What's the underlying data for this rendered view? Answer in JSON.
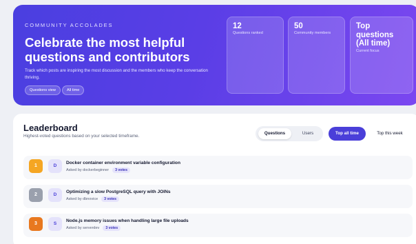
{
  "hero": {
    "eyebrow": "COMMUNITY ACCOLADES",
    "title": "Celebrate the most helpful questions and contributors",
    "description": "Track which posts are inspiring the most discussion and the members who keep the conversation thriving.",
    "chips": [
      "Questions view",
      "All time"
    ],
    "stats": [
      {
        "value": "12",
        "label": "Questions ranked"
      },
      {
        "value": "50",
        "label": "Community members"
      },
      {
        "value": "Top questions (All time)",
        "label": "Current focus"
      }
    ]
  },
  "leaderboard": {
    "title": "Leaderboard",
    "subtitle": "Highest-voted questions based on your selected timeframe.",
    "view_toggle": {
      "active": "Questions",
      "inactive": "Users"
    },
    "timeframes": {
      "active": "Top all time",
      "inactive": "Top this week"
    },
    "rows": [
      {
        "rank": "1",
        "initial": "D",
        "title": "Docker container environment variable configuration",
        "asked_by": "Asked by dockerbeginner",
        "votes": "3 votes",
        "rank_color": "#f5a623"
      },
      {
        "rank": "2",
        "initial": "D",
        "title": "Optimizing a slow PostgreSQL query with JOINs",
        "asked_by": "Asked by dbnovice",
        "votes": "3 votes",
        "rank_color": "#9aa0ad"
      },
      {
        "rank": "3",
        "initial": "S",
        "title": "Node.js memory issues when handling large file uploads",
        "asked_by": "Asked by serverdev",
        "votes": "3 votes",
        "rank_color": "#e8781f"
      }
    ]
  },
  "colors": {
    "accent": "#4a3fd9",
    "hero_start": "#4a3fe0",
    "hero_end": "#7b47f0"
  }
}
